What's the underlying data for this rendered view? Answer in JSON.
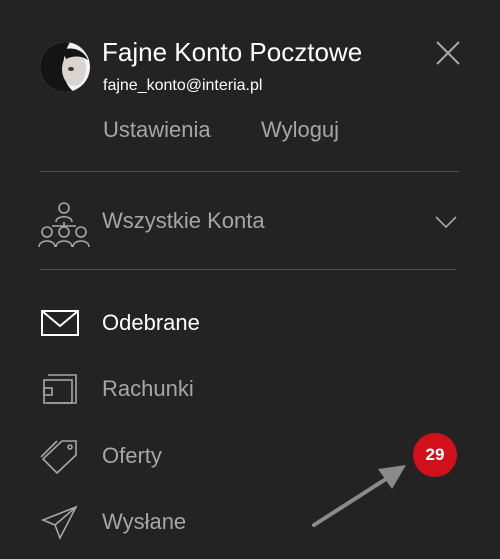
{
  "account": {
    "name": "Fajne Konto Pocztowe",
    "email": "fajne_konto@interia.pl"
  },
  "links": {
    "settings": "Ustawienia",
    "logout": "Wyloguj"
  },
  "accounts_switcher": {
    "label": "Wszystkie Konta",
    "icon": "accounts-group-icon"
  },
  "nav": {
    "items": [
      {
        "label": "Odebrane",
        "icon": "envelope-icon",
        "active": true
      },
      {
        "label": "Rachunki",
        "icon": "wallet-icon",
        "active": false
      },
      {
        "label": "Oferty",
        "icon": "tags-icon",
        "active": false
      },
      {
        "label": "Wysłane",
        "icon": "paper-plane-icon",
        "active": false
      }
    ]
  },
  "badge": {
    "count": "29",
    "color": "#d2101c"
  },
  "colors": {
    "background": "#232323",
    "text_primary": "#ffffff",
    "text_secondary": "#a6a6a6",
    "divider": "#4d4d4d"
  }
}
